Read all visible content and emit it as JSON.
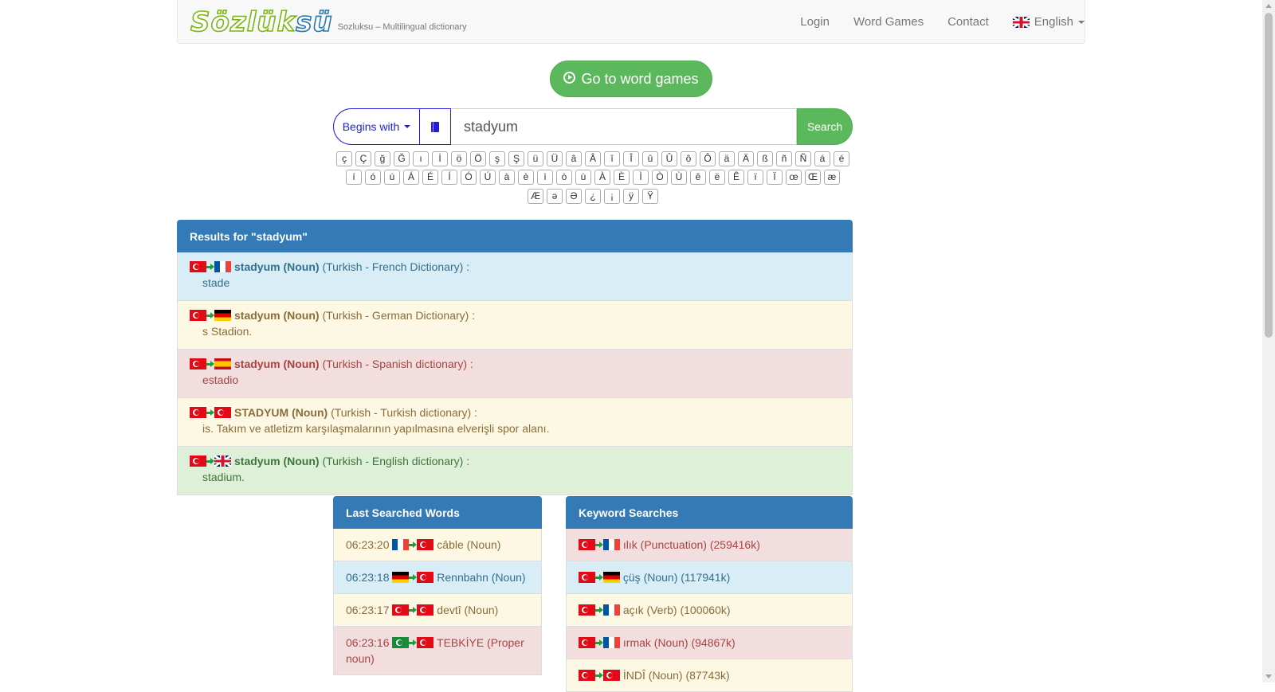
{
  "brand": {
    "logo_a": "Sözlük",
    "logo_b": "sü",
    "tagline": "Sozluksu – Multilingual dictionary"
  },
  "nav": {
    "login": "Login",
    "games": "Word Games",
    "contact": "Contact",
    "language": "English"
  },
  "games_button": "Go to word games",
  "search": {
    "mode": "Begins with",
    "value": "stadyum",
    "button": "Search"
  },
  "special_chars": [
    "ç",
    "Ç",
    "ğ",
    "Ğ",
    "ı",
    "İ",
    "ö",
    "Ö",
    "ş",
    "Ş",
    "ü",
    "Ü",
    "â",
    "Â",
    "î",
    "Î",
    "û",
    "Û",
    "ô",
    "Ô",
    "ä",
    "Ä",
    "ß",
    "ñ",
    "Ñ",
    "á",
    "é",
    "í",
    "ó",
    "ú",
    "Á",
    "É",
    "Í",
    "Ó",
    "Ú",
    "à",
    "è",
    "ì",
    "ò",
    "ù",
    "À",
    "È",
    "Ì",
    "Ò",
    "Ù",
    "ê",
    "ë",
    "Ê",
    "ï",
    "Ï",
    "œ",
    "Œ",
    "æ",
    "Æ",
    "ə",
    "Ə",
    "¿",
    "¡",
    "ÿ",
    "Ÿ"
  ],
  "results": {
    "title": "Results for \"stadyum\"",
    "items": [
      {
        "from": "tr",
        "to": "fr",
        "word": "stadyum (Noun)",
        "dict": "(Turkish - French Dictionary) :",
        "def": "stade",
        "style": "info"
      },
      {
        "from": "tr",
        "to": "de",
        "word": "stadyum (Noun)",
        "dict": "(Turkish - German Dictionary) :",
        "def": "s Stadion.",
        "style": "warn"
      },
      {
        "from": "tr",
        "to": "es",
        "word": "stadyum (Noun)",
        "dict": "(Turkish - Spanish dictionary) :",
        "def": "estadio",
        "style": "dang"
      },
      {
        "from": "tr",
        "to": "tr",
        "word": "STADYUM (Noun)",
        "dict": "(Turkish - Turkish dictionary) :",
        "def": "is. Takım ve atletizm karşılaşmalarının yapılmasına elverişli spor alanı.",
        "style": "warn"
      },
      {
        "from": "tr",
        "to": "gb",
        "word": "stadyum (Noun)",
        "dict": "(Turkish - English dictionary) :",
        "def": "stadium.",
        "style": "succ"
      }
    ]
  },
  "last_searched": {
    "title": "Last Searched Words",
    "items": [
      {
        "time": "06:23:20",
        "from": "fr",
        "to": "tr",
        "word": "câble (Noun)",
        "style": "warn"
      },
      {
        "time": "06:23:18",
        "from": "de",
        "to": "tr",
        "word": "Rennbahn (Noun)",
        "style": "info"
      },
      {
        "time": "06:23:17",
        "from": "tr",
        "to": "tr",
        "word": "devtî (Noun)",
        "style": "warn"
      },
      {
        "time": "06:23:16",
        "from": "ot",
        "to": "tr",
        "word": "TEBKİYE (Proper noun)",
        "style": "dang"
      }
    ]
  },
  "keyword_searches": {
    "title": "Keyword Searches",
    "items": [
      {
        "from": "tr",
        "to": "fr",
        "word": "ılık (Punctuation) (259416k)",
        "style": "dang"
      },
      {
        "from": "tr",
        "to": "de",
        "word": "çüş (Noun) (117941k)",
        "style": "info"
      },
      {
        "from": "tr",
        "to": "fr",
        "word": "açık (Verb) (100060k)",
        "style": "warn"
      },
      {
        "from": "tr",
        "to": "fr",
        "word": "ırmak (Noun) (94867k)",
        "style": "dang"
      },
      {
        "from": "tr",
        "to": "tr",
        "word": "İNDÎ (Noun) (87743k)",
        "style": "warn"
      }
    ]
  }
}
